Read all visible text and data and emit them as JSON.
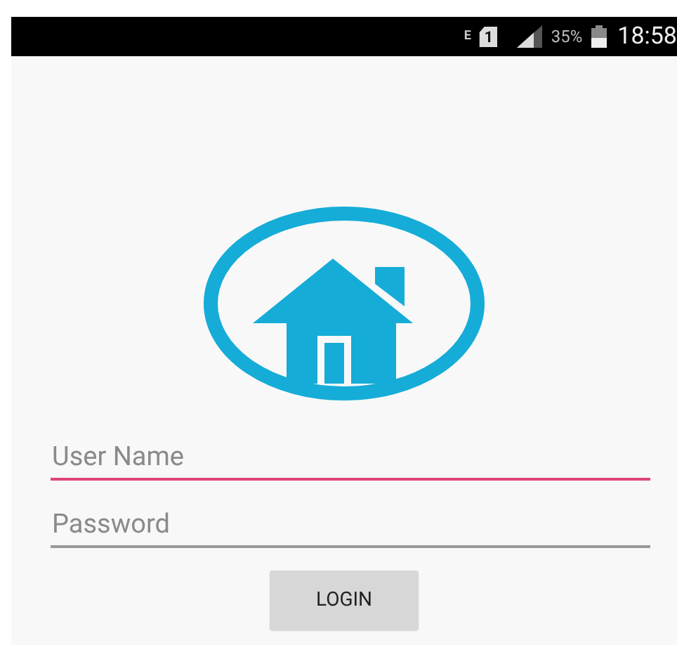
{
  "status_bar": {
    "network_type": "E",
    "sim": "1",
    "battery": "35%",
    "time": "18:58"
  },
  "fields": [
    {
      "placeholder": "User Name",
      "focused": true
    },
    {
      "placeholder": "Password",
      "focused": false
    }
  ],
  "button": "LOGIN"
}
